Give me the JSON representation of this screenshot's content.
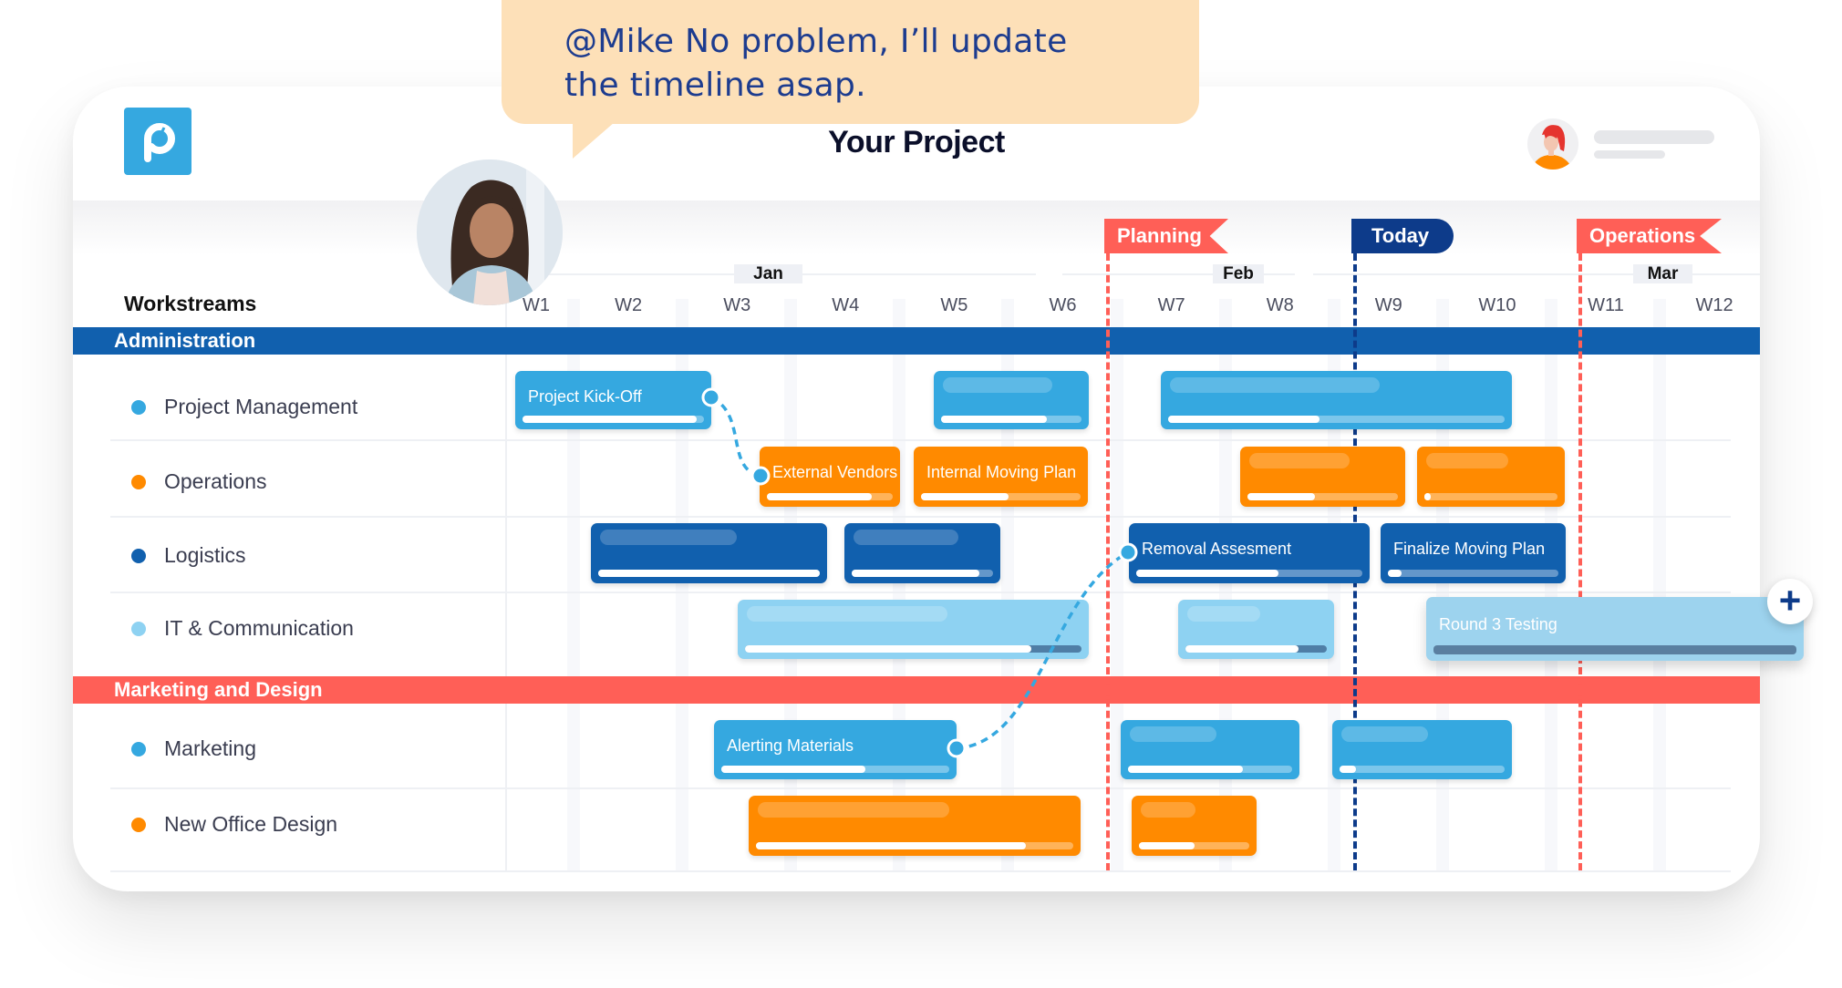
{
  "chat_bubble": {
    "line1": "@Mike No problem, I’ll update",
    "line2": "the timeline asap."
  },
  "header": {
    "title": "Your Project",
    "logo_letter": "p"
  },
  "timeline": {
    "workstreams_label": "Workstreams",
    "months": [
      {
        "label": "Jan"
      },
      {
        "label": "Feb"
      },
      {
        "label": "Mar"
      }
    ],
    "weeks": [
      "W1",
      "W2",
      "W3",
      "W4",
      "W5",
      "W6",
      "W7",
      "W8",
      "W9",
      "W10",
      "W11",
      "W12"
    ],
    "markers": [
      {
        "label": "Planning",
        "color": "#ff5f57",
        "week": 6.5
      },
      {
        "label": "Today",
        "color": "#0d3b8a",
        "week": 8.5
      },
      {
        "label": "Operations",
        "color": "#ff5f57",
        "week": 10.5
      }
    ]
  },
  "colors": {
    "admin_band": "#1160ae",
    "marketing_band": "#ff5f57",
    "blue": "#35a8e0",
    "orange": "#ff8a00",
    "dark_blue": "#1160ae",
    "light_blue": "#8ed2f2"
  },
  "groups": [
    {
      "label": "Administration",
      "rows": [
        {
          "label": "Project Management",
          "color": "#35a8e0",
          "tasks": [
            {
              "label": "Project Kick-Off",
              "progress": 0.96
            },
            {
              "label": "",
              "progress": 0.75
            },
            {
              "label": "",
              "progress": 0.45
            }
          ]
        },
        {
          "label": "Operations",
          "color": "#ff8a00",
          "tasks": [
            {
              "label": "External Vendors",
              "progress": 0.83
            },
            {
              "label": "Internal Moving Plan",
              "progress": 0.55
            },
            {
              "label": "",
              "progress": 0.45
            },
            {
              "label": "",
              "progress": 0.05
            }
          ]
        },
        {
          "label": "Logistics",
          "color": "#1160ae",
          "tasks": [
            {
              "label": "",
              "progress": 1.0
            },
            {
              "label": "",
              "progress": 0.9
            },
            {
              "label": "Removal Assesment",
              "progress": 0.63
            },
            {
              "label": "Finalize Moving Plan",
              "progress": 0.08
            }
          ]
        },
        {
          "label": "IT & Communication",
          "color": "#8ed2f2",
          "tasks": [
            {
              "label": "",
              "progress": 0.85
            },
            {
              "label": "",
              "progress": 0.8
            },
            {
              "label": "Round 3 Testing",
              "progress": 0.0
            }
          ]
        }
      ]
    },
    {
      "label": "Marketing and Design",
      "rows": [
        {
          "label": "Marketing",
          "color": "#35a8e0",
          "tasks": [
            {
              "label": "Alerting Materials",
              "progress": 0.63
            },
            {
              "label": "",
              "progress": 0.7
            },
            {
              "label": "",
              "progress": 0.1
            }
          ]
        },
        {
          "label": "New Office Design",
          "color": "#ff8a00",
          "tasks": [
            {
              "label": "",
              "progress": 0.85
            },
            {
              "label": "",
              "progress": 0.5
            }
          ]
        }
      ]
    }
  ],
  "actions": {
    "add_task_icon": "plus-icon",
    "add_task_symbol": "+"
  }
}
